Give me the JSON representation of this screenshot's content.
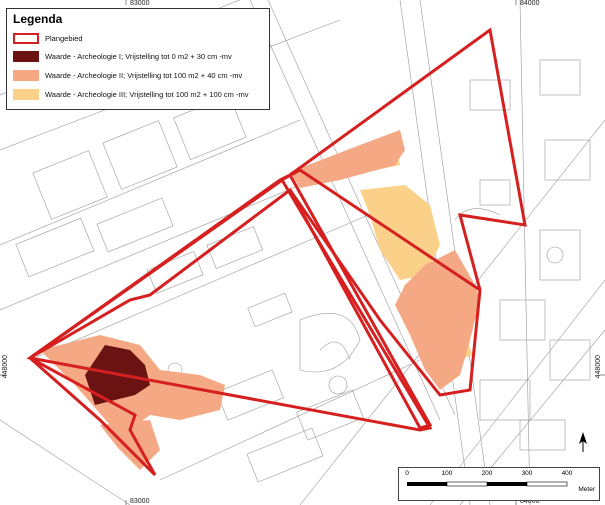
{
  "legend": {
    "title": "Legenda",
    "items": [
      {
        "label": "Plangebied",
        "fill": "#ffffff",
        "stroke": "#d62020"
      },
      {
        "label": "Waarde - Archeologie I; Vrijstelling tot 0 m2 + 30 cm -mv",
        "fill": "#6b1212",
        "stroke": "#6b1212"
      },
      {
        "label": "Waarde - Archeologie II; Vrijstelling tot 100 m2 + 40 cm -mv",
        "fill": "#f4a883",
        "stroke": "#f4a883"
      },
      {
        "label": "Waarde - Archeologie III; Vrijstelling tot 100 m2 + 100 cm -mv",
        "fill": "#fbd18a",
        "stroke": "#fbd18a"
      }
    ]
  },
  "coordinates": {
    "top": [
      "83000",
      "84000"
    ],
    "bottom": [
      "83000",
      "84000"
    ],
    "left": "448000",
    "right": "448000"
  },
  "scalebar": {
    "ticks": [
      "0",
      "100",
      "200",
      "300",
      "400"
    ],
    "unit": "Meter"
  },
  "north_arrow": {
    "icon": "north-arrow-icon"
  },
  "colors": {
    "plangebied": "#d62020",
    "archeologie_I": "#6b1212",
    "archeologie_II": "#f4a883",
    "archeologie_III": "#fbd18a"
  }
}
